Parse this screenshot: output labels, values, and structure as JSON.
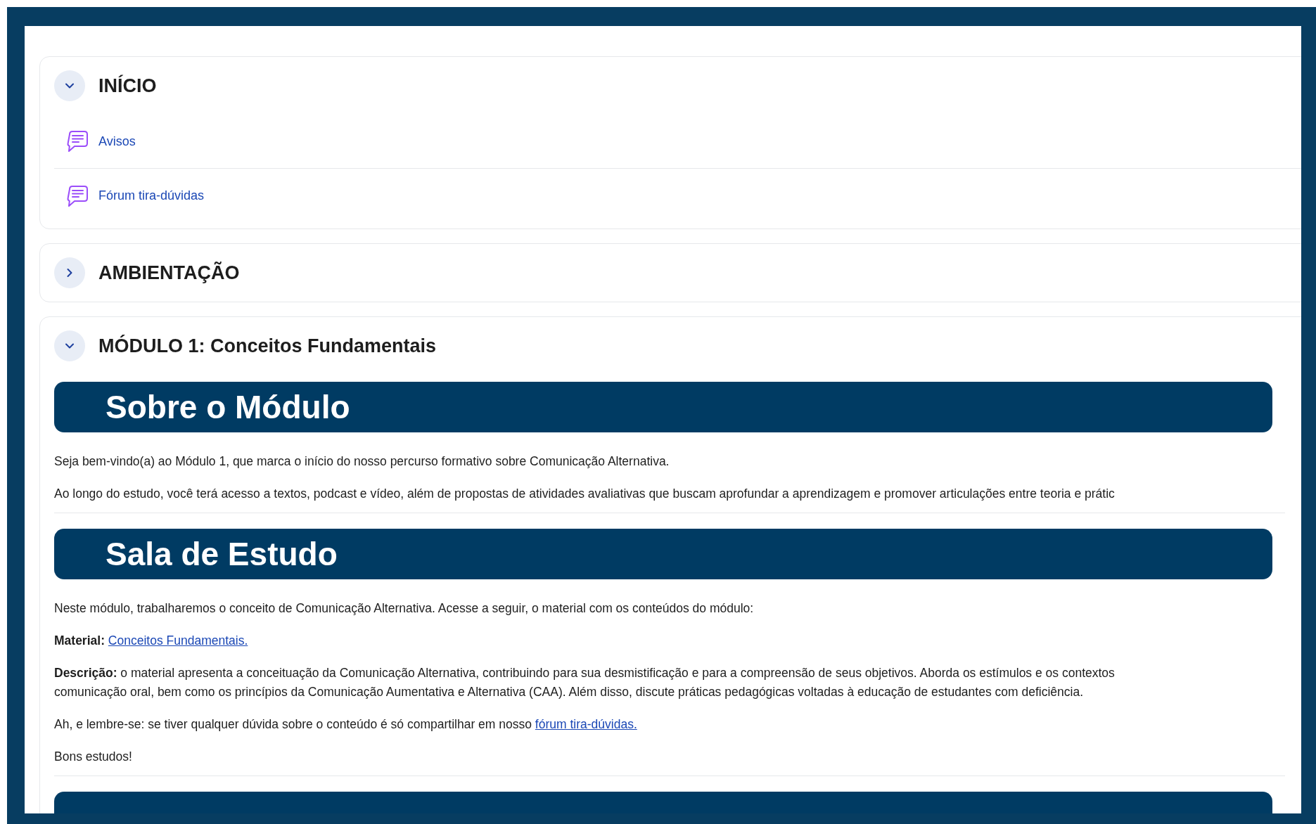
{
  "sections": [
    {
      "title": "INÍCIO",
      "expanded": true,
      "items": [
        {
          "label": "Avisos"
        },
        {
          "label": "Fórum tira-dúvidas"
        }
      ]
    },
    {
      "title": "AMBIENTAÇÃO",
      "expanded": false
    },
    {
      "title": "MÓDULO 1: Conceitos Fundamentais",
      "expanded": true,
      "blocks": [
        {
          "kind": "banner",
          "text": "Sobre o Módulo"
        },
        {
          "kind": "paragraph",
          "lines": [
            "Seja bem-vindo(a) ao Módulo 1, que marca o início do nosso percurso formativo sobre Comunicação Alternativa."
          ]
        },
        {
          "kind": "paragraph",
          "lines": [
            "Ao longo do estudo, você terá acesso a textos, podcast e vídeo, além de propostas de atividades avaliativas que buscam aprofundar a aprendizagem e promover articulações entre teoria e prátic"
          ]
        },
        {
          "kind": "divider"
        },
        {
          "kind": "banner",
          "text": "Sala de Estudo"
        },
        {
          "kind": "paragraph",
          "lines": [
            "Neste módulo, trabalharemos o conceito de Comunicação Alternativa. Acesse a seguir, o material com os conteúdos do módulo:"
          ]
        },
        {
          "kind": "link_paragraph",
          "text": "**Material:**",
          "link": "Conceitos Fundamentais."
        },
        {
          "kind": "paragraph",
          "lines": [
            "**Descrição:** o material apresenta a conceituação da Comunicação Alternativa, contribuindo para sua desmistificação e para a compreensão de seus objetivos. Aborda os estímulos e os contextos",
            "comunicação oral, bem como os princípios da Comunicação Aumentativa e Alternativa (CAA). Além disso, discute práticas pedagógicas voltadas à educação de estudantes com deficiência."
          ]
        },
        {
          "kind": "link_paragraph",
          "text": "Ah, e lembre-se: se tiver qualquer dúvida sobre o conteúdo é só compartilhar em nosso",
          "link": "fórum tira-dúvidas."
        },
        {
          "kind": "paragraph",
          "lines": [
            "Bons estudos!"
          ]
        },
        {
          "kind": "divider"
        },
        {
          "kind": "banner"
        }
      ]
    }
  ]
}
